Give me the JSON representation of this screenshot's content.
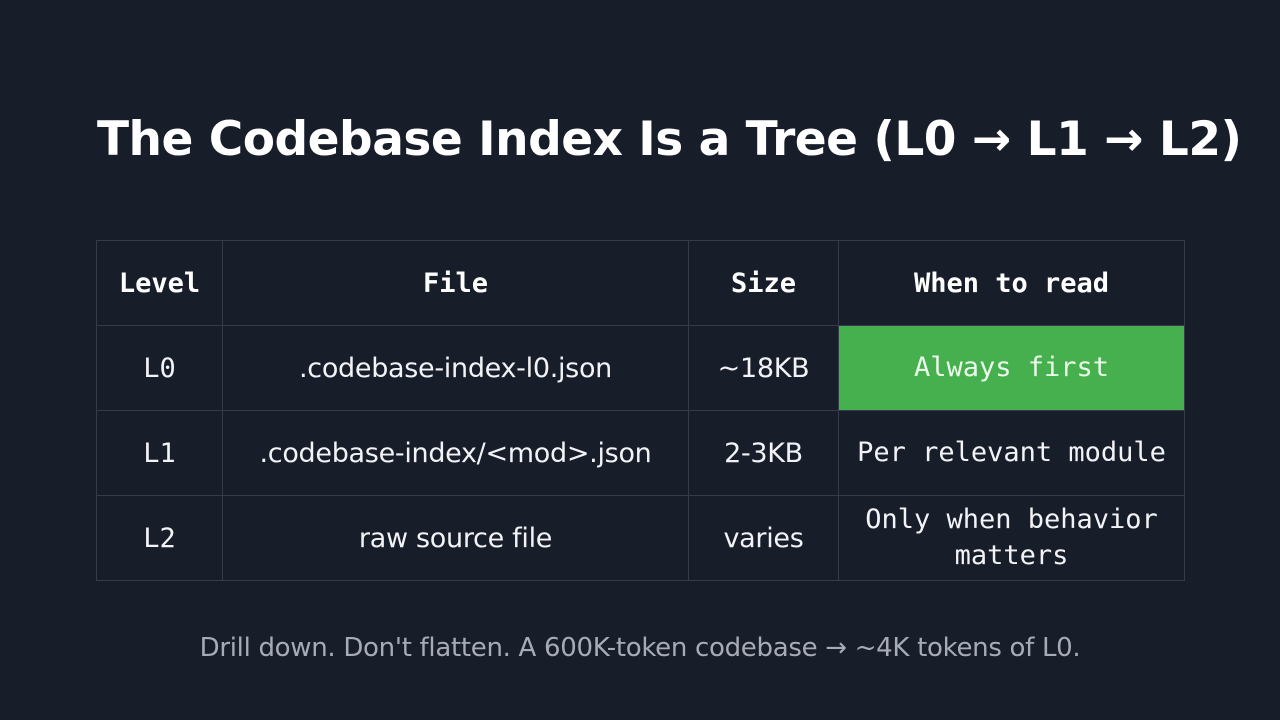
{
  "slide": {
    "title": "The Codebase Index Is a Tree (L0 → L1 → L2)",
    "footer": "Drill down. Don't flatten. A 600K-token codebase → ~4K tokens of L0."
  },
  "table": {
    "headers": {
      "level": "Level",
      "file": "File",
      "size": "Size",
      "when": "When to read"
    },
    "rows": [
      {
        "level": "L0",
        "file": ".codebase-index-l0.json",
        "size": "~18KB",
        "when": "Always first"
      },
      {
        "level": "L1",
        "file": ".codebase-index/<mod>.json",
        "size": "2-3KB",
        "when": "Per relevant module"
      },
      {
        "level": "L2",
        "file": "raw source file",
        "size": "varies",
        "when": "Only when behavior matters"
      }
    ]
  },
  "colors": {
    "background": "#181d2a",
    "highlight": "#45b04d",
    "grid": "#353b4b",
    "footer_text": "#a7abb5"
  }
}
